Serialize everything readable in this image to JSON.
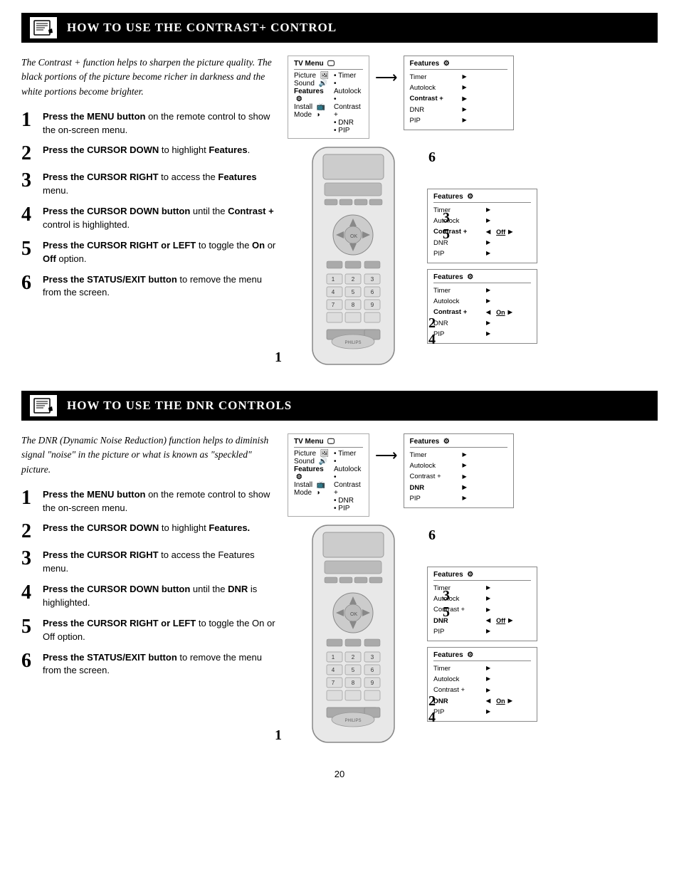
{
  "section1": {
    "title": "How to use the Contrast+ Control",
    "intro": "The Contrast + function helps to sharpen the picture quality. The black portions of the picture become richer in darkness and the white portions become brighter.",
    "steps": [
      {
        "num": "1",
        "text_before_bold": "",
        "bold": "Press the MENU button",
        "text_after": " on the remote control to show the on-screen menu."
      },
      {
        "num": "2",
        "text_before_bold": "",
        "bold": "Press the CURSOR DOWN",
        "text_after": " to highlight Features."
      },
      {
        "num": "3",
        "text_before_bold": "",
        "bold": "Press the CURSOR RIGHT",
        "text_after": " to access the Features menu."
      },
      {
        "num": "4",
        "text_before_bold": "",
        "bold": "Press the CURSOR DOWN button",
        "text_after": " until the Contrast + control is highlighted."
      },
      {
        "num": "5",
        "text_before_bold": "",
        "bold": "Press the CURSOR RIGHT or LEFT",
        "text_after": " to toggle the On or Off option."
      },
      {
        "num": "6",
        "text_before_bold": "",
        "bold": "Press the STATUS/EXIT button",
        "text_after": " to remove the menu from the screen."
      }
    ],
    "tv_menu": {
      "title": "TV Menu",
      "left_items": [
        "Picture",
        "Sound",
        "Features",
        "Install",
        "Mode"
      ],
      "right_items": [
        "• Timer",
        "• Autolock",
        "• Contrast +",
        "• DNR",
        "• PIP"
      ],
      "bold_left": "Features"
    },
    "menus": [
      {
        "title": "Features",
        "rows": [
          {
            "label": "Timer",
            "arrow": "▶",
            "bold": false,
            "option": ""
          },
          {
            "label": "Autolock",
            "arrow": "▶",
            "bold": false,
            "option": ""
          },
          {
            "label": "Contrast +",
            "arrow": "▶",
            "bold": true,
            "option": ""
          },
          {
            "label": "DNR",
            "arrow": "▶",
            "bold": false,
            "option": ""
          },
          {
            "label": "PIP",
            "arrow": "▶",
            "bold": false,
            "option": ""
          }
        ]
      },
      {
        "title": "Features",
        "rows": [
          {
            "label": "Timer",
            "arrow": "▶",
            "bold": false,
            "option": ""
          },
          {
            "label": "Autolock",
            "arrow": "▶",
            "bold": false,
            "option": ""
          },
          {
            "label": "Contrast +",
            "arrow": "▶",
            "bold": true,
            "option": "Off"
          },
          {
            "label": "DNR",
            "arrow": "▶",
            "bold": false,
            "option": ""
          },
          {
            "label": "PIP",
            "arrow": "▶",
            "bold": false,
            "option": ""
          }
        ]
      },
      {
        "title": "Features",
        "rows": [
          {
            "label": "Timer",
            "arrow": "▶",
            "bold": false,
            "option": ""
          },
          {
            "label": "Autolock",
            "arrow": "▶",
            "bold": false,
            "option": ""
          },
          {
            "label": "Contrast +",
            "arrow": "▶",
            "bold": true,
            "option": "On"
          },
          {
            "label": "DNR",
            "arrow": "▶",
            "bold": false,
            "option": ""
          },
          {
            "label": "PIP",
            "arrow": "▶",
            "bold": false,
            "option": ""
          }
        ]
      }
    ]
  },
  "section2": {
    "title": "How to use the DNR Controls",
    "intro": "The DNR (Dynamic Noise Reduction) function helps to diminish signal \"noise\" in the picture or what is known as \"speckled\" picture.",
    "steps": [
      {
        "num": "1",
        "bold": "Press the MENU button",
        "text_after": " on the remote control to show the on-screen menu."
      },
      {
        "num": "2",
        "bold": "Press the CURSOR DOWN",
        "text_after": " to highlight Features."
      },
      {
        "num": "3",
        "bold": "Press the CURSOR RIGHT",
        "text_after": " to access the Features menu."
      },
      {
        "num": "4",
        "bold": "Press the CURSOR DOWN button",
        "text_after": " until the DNR is highlighted."
      },
      {
        "num": "5",
        "bold": "Press the CURSOR RIGHT or LEFT",
        "text_after": " to toggle the On or Off option."
      },
      {
        "num": "6",
        "bold": "Press the STATUS/EXIT button",
        "text_after": " to remove the menu from the screen."
      }
    ],
    "tv_menu": {
      "title": "TV Menu",
      "left_items": [
        "Picture",
        "Sound",
        "Features",
        "Install",
        "Mode"
      ],
      "right_items": [
        "• Timer",
        "• Autolock",
        "• Contrast +",
        "• DNR",
        "• PIP"
      ],
      "bold_left": "Features"
    },
    "menus": [
      {
        "title": "Features",
        "rows": [
          {
            "label": "Timer",
            "arrow": "▶",
            "bold": false,
            "option": ""
          },
          {
            "label": "Autolock",
            "arrow": "▶",
            "bold": false,
            "option": ""
          },
          {
            "label": "Contrast +",
            "arrow": "▶",
            "bold": false,
            "option": ""
          },
          {
            "label": "DNR",
            "arrow": "▶",
            "bold": true,
            "option": ""
          },
          {
            "label": "PIP",
            "arrow": "▶",
            "bold": false,
            "option": ""
          }
        ]
      },
      {
        "title": "Features",
        "rows": [
          {
            "label": "Timer",
            "arrow": "▶",
            "bold": false,
            "option": ""
          },
          {
            "label": "Autolock",
            "arrow": "▶",
            "bold": false,
            "option": ""
          },
          {
            "label": "Contrast +",
            "arrow": "▶",
            "bold": false,
            "option": ""
          },
          {
            "label": "DNR",
            "arrow": "▶",
            "bold": true,
            "option": "Off"
          },
          {
            "label": "PIP",
            "arrow": "▶",
            "bold": false,
            "option": ""
          }
        ]
      },
      {
        "title": "Features",
        "rows": [
          {
            "label": "Timer",
            "arrow": "▶",
            "bold": false,
            "option": ""
          },
          {
            "label": "Autolock",
            "arrow": "▶",
            "bold": false,
            "option": ""
          },
          {
            "label": "Contrast +",
            "arrow": "▶",
            "bold": false,
            "option": ""
          },
          {
            "label": "DNR",
            "arrow": "▶",
            "bold": true,
            "option": "On"
          },
          {
            "label": "PIP",
            "arrow": "▶",
            "bold": false,
            "option": ""
          }
        ]
      }
    ]
  },
  "page_number": "20",
  "step_labels_right": {
    "section1": [
      "6",
      "3",
      "5",
      "2",
      "4"
    ],
    "section2": [
      "6",
      "3",
      "5",
      "2",
      "4"
    ]
  }
}
